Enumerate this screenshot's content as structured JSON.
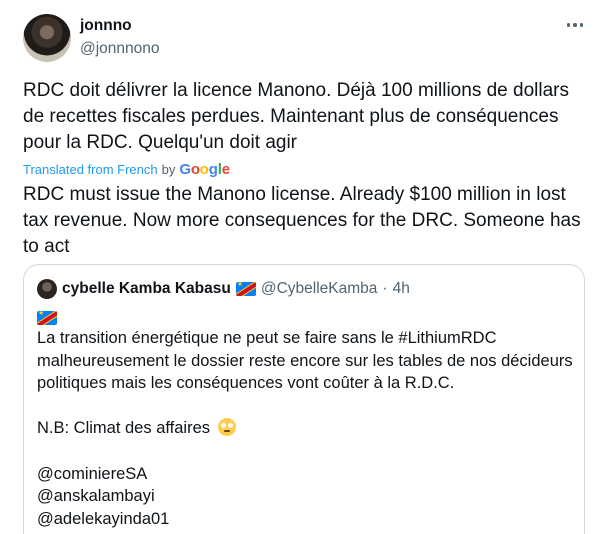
{
  "tweet": {
    "author_name": "jonnno",
    "author_handle": "@jonnnono",
    "original_text": "RDC doit délivrer la licence Manono. Déjà 100 millions de dollars de recettes fiscales perdues. Maintenant plus de conséquences pour la RDC. Quelqu'un doit agir",
    "translated_from_label": "Translated from French",
    "translated_by_label": "by",
    "translator_name": "Google",
    "translation_text": "RDC must issue the Manono license. Already $100 million in lost tax revenue. Now more consequences for the DRC. Someone has to act"
  },
  "quoted_tweet": {
    "author_name": "cybelle Kamba Kabasu",
    "author_handle": "@CybelleKamba",
    "separator": "·",
    "time": "4h",
    "body_lines": [
      "La transition énergétique ne peut se faire sans le #LithiumRDC malheureusement le dossier reste encore sur les tables de nos décideurs politiques mais les conséquences vont coûter à la R.D.C.",
      "",
      "N.B:  Climat des affaires",
      "",
      "@cominiereSA",
      "@anskalambayi",
      "@adelekayinda01"
    ]
  },
  "icons": {
    "more": "more-horizontal-icon",
    "flag": "congo-flag-icon",
    "emoji": "face-with-rolling-eyes-emoji"
  },
  "colors": {
    "text": "#0f1419",
    "secondary": "#536471",
    "link": "#1d9bf0",
    "border": "#cfd9de"
  }
}
